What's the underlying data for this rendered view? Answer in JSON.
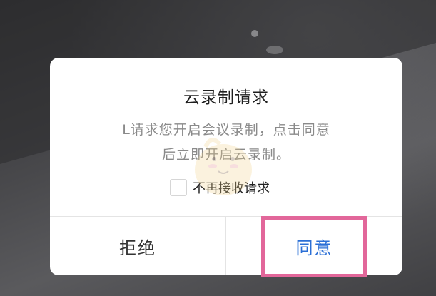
{
  "dialog": {
    "title": "云录制请求",
    "message_line1": "L请求您开启会议录制，点击同意",
    "message_line2": "后立即开启云录制。",
    "checkbox_label": "不再接收请求",
    "checkbox_checked": false,
    "decline_label": "拒绝",
    "agree_label": "同意"
  },
  "colors": {
    "agree_text": "#2b6fd6",
    "highlight_border": "#e2679a",
    "message_text": "#8a8a8a"
  }
}
